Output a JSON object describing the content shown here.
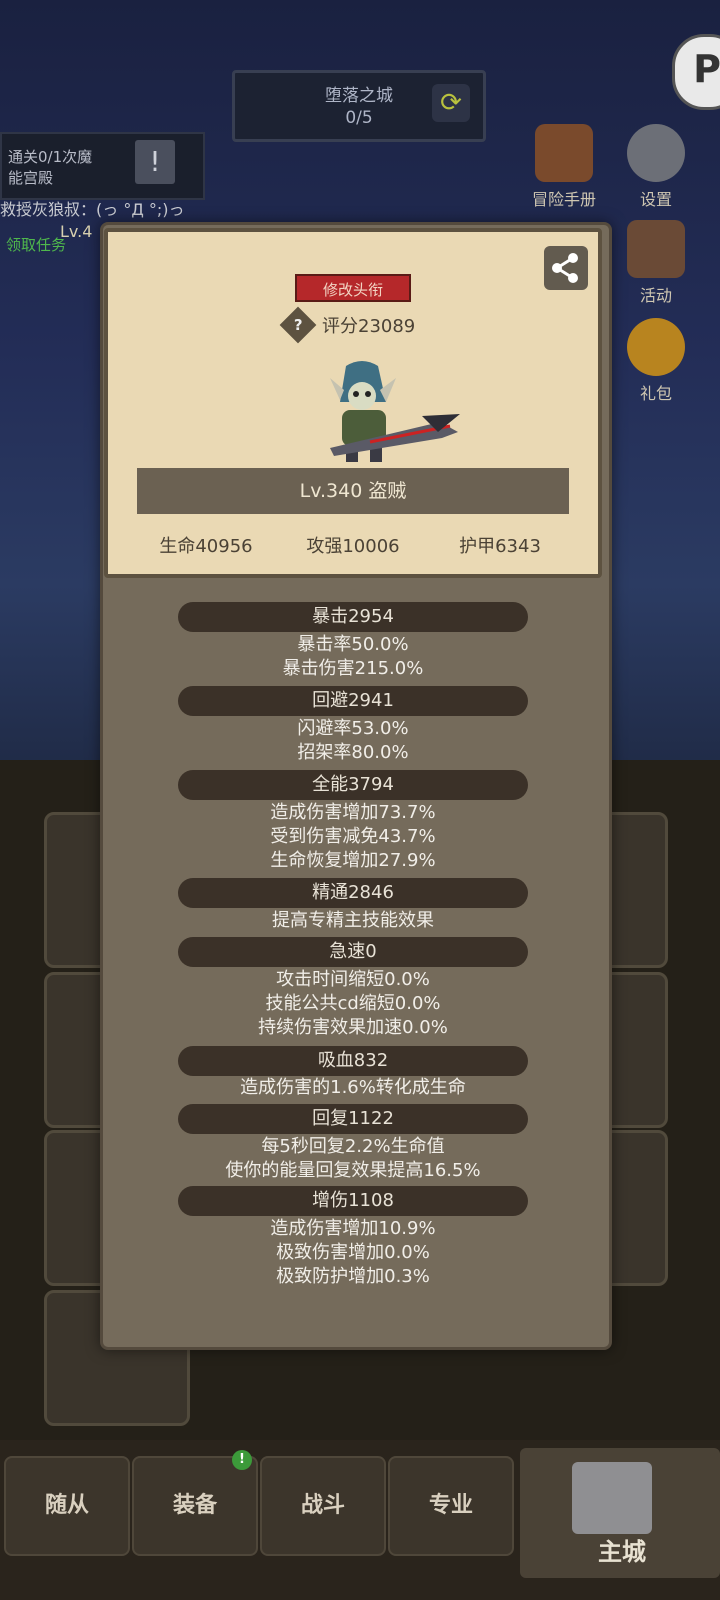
{
  "hud": {
    "city_name": "堕落之城",
    "city_progress": "0/5",
    "quest_line1": "通关0/1次魔",
    "quest_line1b": "能宫殿",
    "quest_line2": "救授灰狼叔：(っ °Д °;)っ",
    "quest_line3": "领取任务",
    "quest_level": "Lv.4",
    "top_right_letter": "P"
  },
  "side_menu": [
    {
      "label": "冒险手册",
      "icon": "book-icon"
    },
    {
      "label": "设置",
      "icon": "gear-icon"
    },
    {
      "label": "活动",
      "icon": "calendar-icon"
    },
    {
      "label": "礼包",
      "icon": "gift-icon"
    }
  ],
  "dialog": {
    "title_button": "修改头衔",
    "score": "评分23089",
    "level_class": "Lv.340 盗贼",
    "basic_stats": [
      "生命40956",
      "攻强10006",
      "护甲6343"
    ],
    "categories": [
      {
        "name": "暴击2954",
        "lines": [
          "暴击率50.0%",
          "暴击伤害215.0%"
        ]
      },
      {
        "name": "回避2941",
        "lines": [
          "闪避率53.0%",
          "招架率80.0%"
        ]
      },
      {
        "name": "全能3794",
        "lines": [
          "造成伤害增加73.7%",
          "受到伤害减免43.7%",
          "生命恢复增加27.9%"
        ]
      },
      {
        "name": "精通2846",
        "lines": [
          "提高专精主技能效果"
        ]
      },
      {
        "name": "急速0",
        "lines": [
          "攻击时间缩短0.0%",
          "技能公共cd缩短0.0%",
          "持续伤害效果加速0.0%"
        ]
      },
      {
        "name": "吸血832",
        "lines": [
          "造成伤害的1.6%转化成生命"
        ]
      },
      {
        "name": "回复1122",
        "lines": [
          "每5秒回复2.2%生命值",
          "使你的能量回复效果提高16.5%"
        ]
      },
      {
        "name": "增伤1108",
        "lines": [
          "造成伤害增加10.9%",
          "极致伤害增加0.0%",
          "极致防护增加0.3%"
        ]
      }
    ]
  },
  "bottom_nav": {
    "tabs": [
      "随从",
      "装备",
      "战斗",
      "专业"
    ],
    "main": "主城",
    "badge": "!"
  },
  "colors": {
    "accent_red": "#b5282a",
    "panel_parchment": "#ead9b4",
    "dialog_body": "#756b5b",
    "bar_dark": "#3b3128"
  }
}
